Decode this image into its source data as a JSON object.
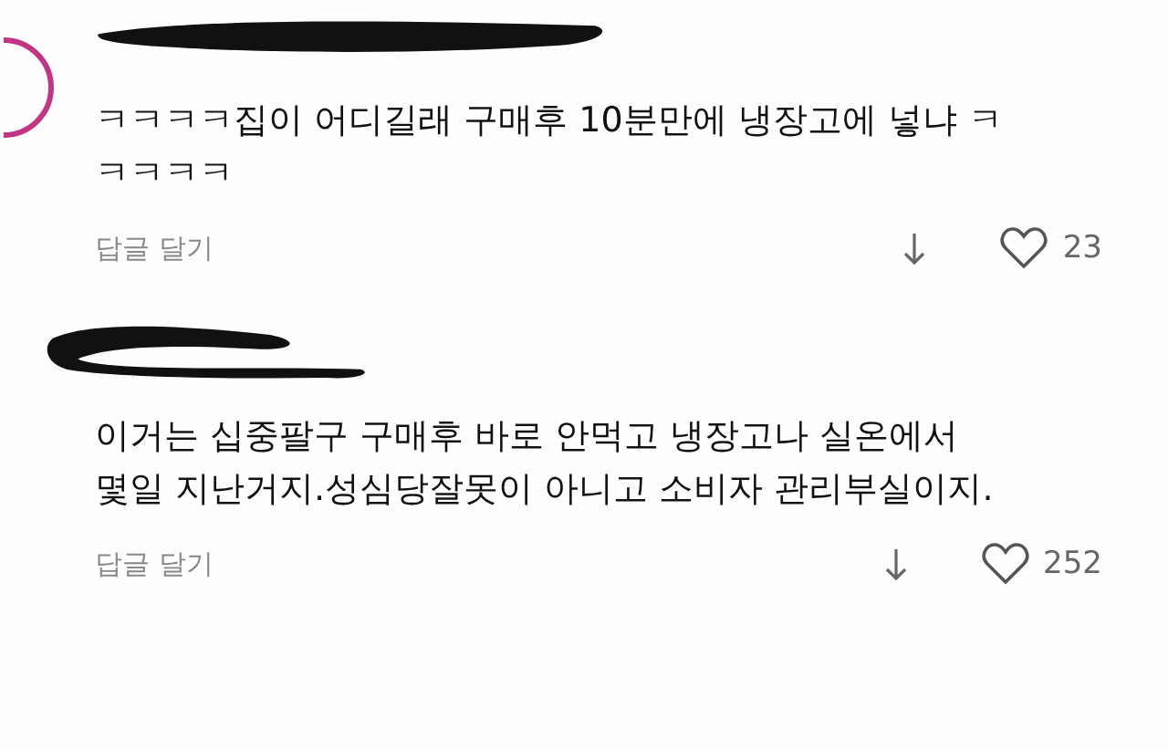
{
  "comments": [
    {
      "lines": [
        "ㅋㅋㅋㅋ집이 어디길래 구매후 10분만에 냉장고에 넣냐 ㅋ",
        "ㅋㅋㅋㅋ"
      ],
      "reply_label": "답글 달기",
      "liked": false,
      "like_count": "23",
      "avatar": true
    },
    {
      "lines": [
        "이거는 십중팔구 구매후 바로 안먹고 냉장고나 실온에서",
        "몇일 지난거지.성심당잘못이 아니고 소비자 관리부실이지."
      ],
      "reply_label": "답글 달기",
      "liked": false,
      "like_count": "252",
      "avatar": false
    }
  ]
}
